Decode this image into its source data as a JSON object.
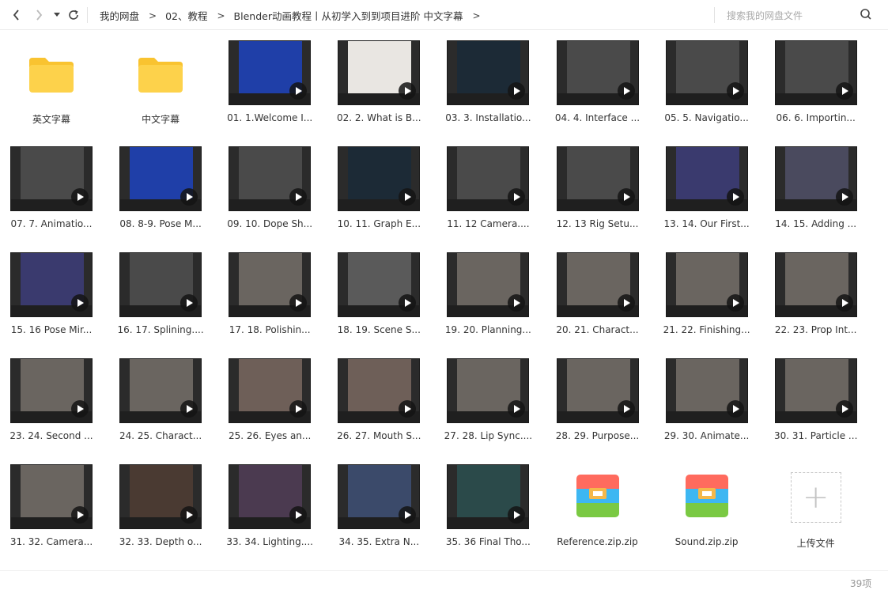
{
  "toolbar": {
    "back_icon": "chevron-left-icon",
    "forward_icon": "chevron-right-icon",
    "dropdown_icon": "caret-down-icon",
    "refresh_icon": "refresh-icon"
  },
  "breadcrumb": {
    "items": [
      "我的网盘",
      "02、教程",
      "Blender动画教程丨从初学入到到项目进阶 中文字幕"
    ],
    "separator": ">"
  },
  "search": {
    "placeholder": "搜索我的网盘文件",
    "icon": "search-icon"
  },
  "colors": {
    "folder": "#fdd24b",
    "folder_tab": "#f9c330",
    "zip_top": "#ff6b5e",
    "zip_mid": "#3db7f2",
    "zip_bottom": "#7ac943",
    "zip_clasp": "#f5b84a"
  },
  "files": [
    {
      "name": "英文字幕",
      "type": "folder"
    },
    {
      "name": "中文字幕",
      "type": "folder"
    },
    {
      "name": "01. 1.Welcome I...",
      "type": "video",
      "theme": "blue"
    },
    {
      "name": "02. 2. What is B...",
      "type": "video",
      "theme": "white"
    },
    {
      "name": "03. 3. Installatio...",
      "type": "video",
      "theme": "dark"
    },
    {
      "name": "04. 4. Interface ...",
      "type": "video",
      "theme": "gray"
    },
    {
      "name": "05. 5. Navigatio...",
      "type": "video",
      "theme": "gray"
    },
    {
      "name": "06. 6. Importin...",
      "type": "video",
      "theme": "gray"
    },
    {
      "name": "07. 7. Animatio...",
      "type": "video",
      "theme": "gray"
    },
    {
      "name": "08. 8-9. Pose M...",
      "type": "video",
      "theme": "blue"
    },
    {
      "name": "09. 10. Dope Sh...",
      "type": "video",
      "theme": "gray"
    },
    {
      "name": "10. 11. Graph E...",
      "type": "video",
      "theme": "dark"
    },
    {
      "name": "11. 12 Camera....",
      "type": "video",
      "theme": "gray"
    },
    {
      "name": "12. 13 Rig Setu...",
      "type": "video",
      "theme": "gray"
    },
    {
      "name": "13. 14. Our First...",
      "type": "video",
      "theme": "purple"
    },
    {
      "name": "14. 15. Adding ...",
      "type": "video",
      "theme": "orange"
    },
    {
      "name": "15. 16 Pose Mir...",
      "type": "video",
      "theme": "purple"
    },
    {
      "name": "16. 17. Splining....",
      "type": "video",
      "theme": "gray"
    },
    {
      "name": "17. 18. Polishin...",
      "type": "video",
      "theme": "scene"
    },
    {
      "name": "18. 19. Scene S...",
      "type": "video",
      "theme": "cyan"
    },
    {
      "name": "19. 20. Planning...",
      "type": "video",
      "theme": "scene"
    },
    {
      "name": "20. 21. Charact...",
      "type": "video",
      "theme": "scene"
    },
    {
      "name": "21. 22. Finishing...",
      "type": "video",
      "theme": "scene"
    },
    {
      "name": "22. 23. Prop Int...",
      "type": "video",
      "theme": "scene"
    },
    {
      "name": "23. 24. Second ...",
      "type": "video",
      "theme": "scene"
    },
    {
      "name": "24. 25. Charact...",
      "type": "video",
      "theme": "scene"
    },
    {
      "name": "25. 26. Eyes an...",
      "type": "video",
      "theme": "face"
    },
    {
      "name": "26. 27. Mouth S...",
      "type": "video",
      "theme": "face"
    },
    {
      "name": "27. 28. Lip Sync....",
      "type": "video",
      "theme": "scene"
    },
    {
      "name": "28. 29. Purpose...",
      "type": "video",
      "theme": "scene"
    },
    {
      "name": "29. 30. Animate...",
      "type": "video",
      "theme": "scene"
    },
    {
      "name": "30. 31. Particle ...",
      "type": "video",
      "theme": "scene"
    },
    {
      "name": "31. 32. Camera...",
      "type": "video",
      "theme": "scene"
    },
    {
      "name": "32. 33. Depth o...",
      "type": "video",
      "theme": "yellow"
    },
    {
      "name": "33. 34. Lighting....",
      "type": "video",
      "theme": "pink"
    },
    {
      "name": "34. 35. Extra N...",
      "type": "video",
      "theme": "grid"
    },
    {
      "name": "35. 36 Final Tho...",
      "type": "video",
      "theme": "teal"
    },
    {
      "name": "Reference.zip.zip",
      "type": "zip"
    },
    {
      "name": "Sound.zip.zip",
      "type": "zip"
    },
    {
      "name": "上传文件",
      "type": "upload"
    }
  ],
  "footer": {
    "count": "39项"
  }
}
